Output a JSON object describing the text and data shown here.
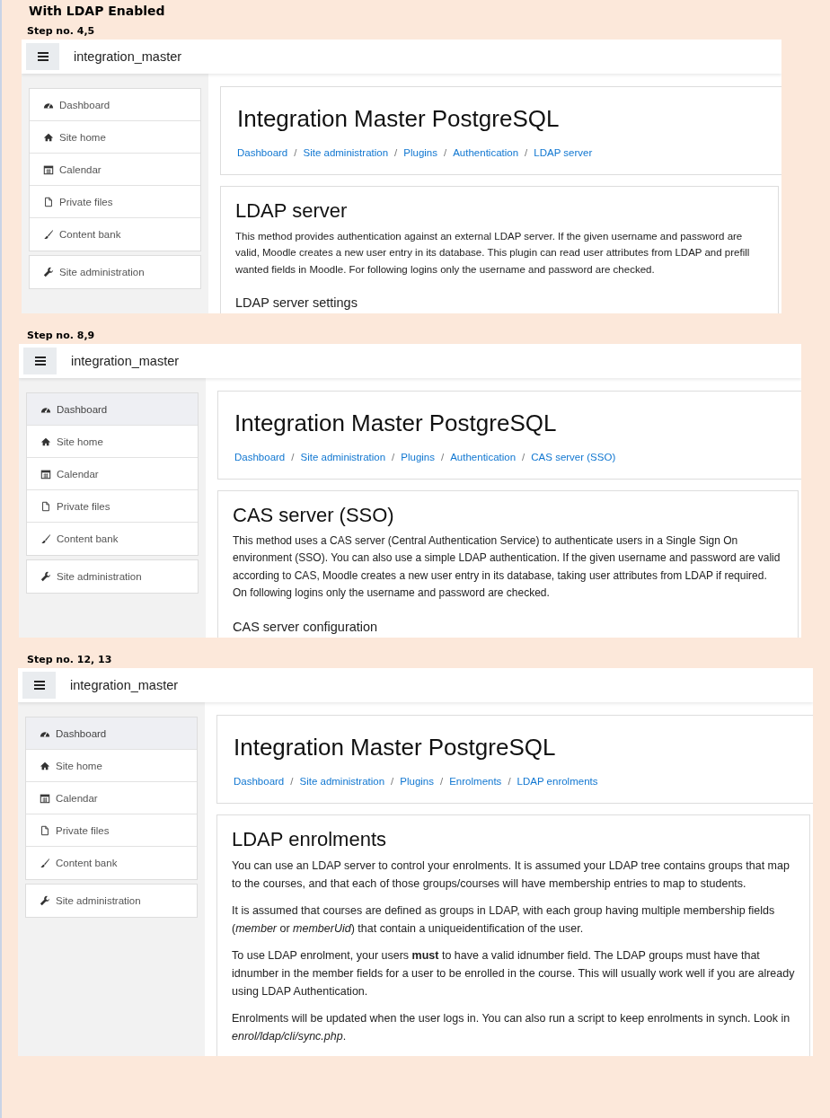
{
  "title": "With LDAP Enabled",
  "breadcrumb_separator": "/",
  "sections": [
    {
      "step": "Step no. 4,5",
      "site_name": "integration_master",
      "nav": [
        {
          "label": "Dashboard",
          "selected": false
        },
        {
          "label": "Site home",
          "selected": false
        },
        {
          "label": "Calendar",
          "selected": false
        },
        {
          "label": "Private files",
          "selected": false
        },
        {
          "label": "Content bank",
          "selected": false
        }
      ],
      "admin": "Site administration",
      "page_title": "Integration Master PostgreSQL",
      "breadcrumbs": [
        "Dashboard",
        "Site administration",
        "Plugins",
        "Authentication",
        "LDAP server"
      ],
      "heading": "LDAP server",
      "paragraphs": [
        "This method provides authentication against an external LDAP server. If the given username and password are valid, Moodle creates a new user entry in its database. This plugin can read user attributes from LDAP and prefill wanted fields in Moodle. For following logins only the username and password are checked."
      ],
      "subheading": "LDAP server settings"
    },
    {
      "step": "Step no. 8,9",
      "site_name": "integration_master",
      "nav": [
        {
          "label": "Dashboard",
          "selected": true
        },
        {
          "label": "Site home",
          "selected": false
        },
        {
          "label": "Calendar",
          "selected": false
        },
        {
          "label": "Private files",
          "selected": false
        },
        {
          "label": "Content bank",
          "selected": false
        }
      ],
      "admin": "Site administration",
      "page_title": "Integration Master PostgreSQL",
      "breadcrumbs": [
        "Dashboard",
        "Site administration",
        "Plugins",
        "Authentication",
        "CAS server (SSO)"
      ],
      "heading": "CAS server (SSO)",
      "paragraphs": [
        "This method uses a CAS server (Central Authentication Service) to authenticate users in a Single Sign On environment (SSO). You can also use a simple LDAP authentication. If the given username and password are valid according to CAS, Moodle creates a new user entry in its database, taking user attributes from LDAP if required. On following logins only the username and password are checked."
      ],
      "subheading": "CAS server configuration"
    },
    {
      "step": "Step no. 12, 13",
      "site_name": "integration_master",
      "nav": [
        {
          "label": "Dashboard",
          "selected": true
        },
        {
          "label": "Site home",
          "selected": false
        },
        {
          "label": "Calendar",
          "selected": false
        },
        {
          "label": "Private files",
          "selected": false
        },
        {
          "label": "Content bank",
          "selected": false
        }
      ],
      "admin": "Site administration",
      "page_title": "Integration Master PostgreSQL",
      "breadcrumbs": [
        "Dashboard",
        "Site administration",
        "Plugins",
        "Enrolments",
        "LDAP enrolments"
      ],
      "heading": "LDAP enrolments",
      "paragraphs": [
        "You can use an LDAP server to control your enrolments. It is assumed your LDAP tree contains groups that map to the courses, and that each of those groups/courses will have membership entries to map to students.",
        "It is assumed that courses are defined as groups in LDAP, with each group having multiple membership fields (*member* or *memberUid*) that contain a uniqueidentification of the user.",
        "To use LDAP enrolment, your users **must** to have a valid idnumber field. The LDAP groups must have that idnumber in the member fields for a user to be enrolled in the course. This will usually work well if you are already using LDAP Authentication.",
        "Enrolments will be updated when the user logs in. You can also run a script to keep enrolments in synch. Look in *enrol/ldap/cli/sync.php*."
      ]
    }
  ]
}
